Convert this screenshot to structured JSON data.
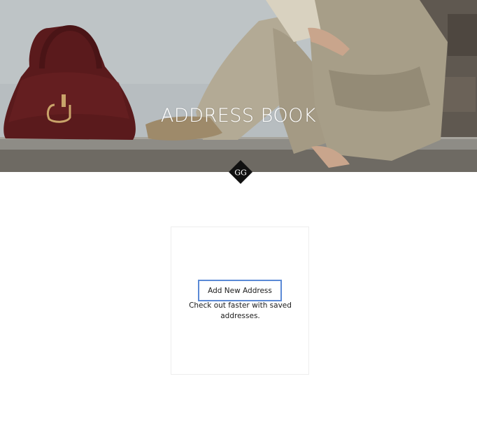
{
  "hero": {
    "title": "ADDRESS BOOK",
    "image_description_icon": "hero-photo"
  },
  "logo": {
    "icon": "gg-monogram-icon",
    "glyph": "GG"
  },
  "address_card": {
    "add_button_label": "Add New Address",
    "description": "Check out faster with saved addresses."
  },
  "colors": {
    "focus_outline": "#5b8ad6",
    "text": "#1b1b1b",
    "logo_bg": "#111111",
    "card_border": "#eeeeee"
  }
}
